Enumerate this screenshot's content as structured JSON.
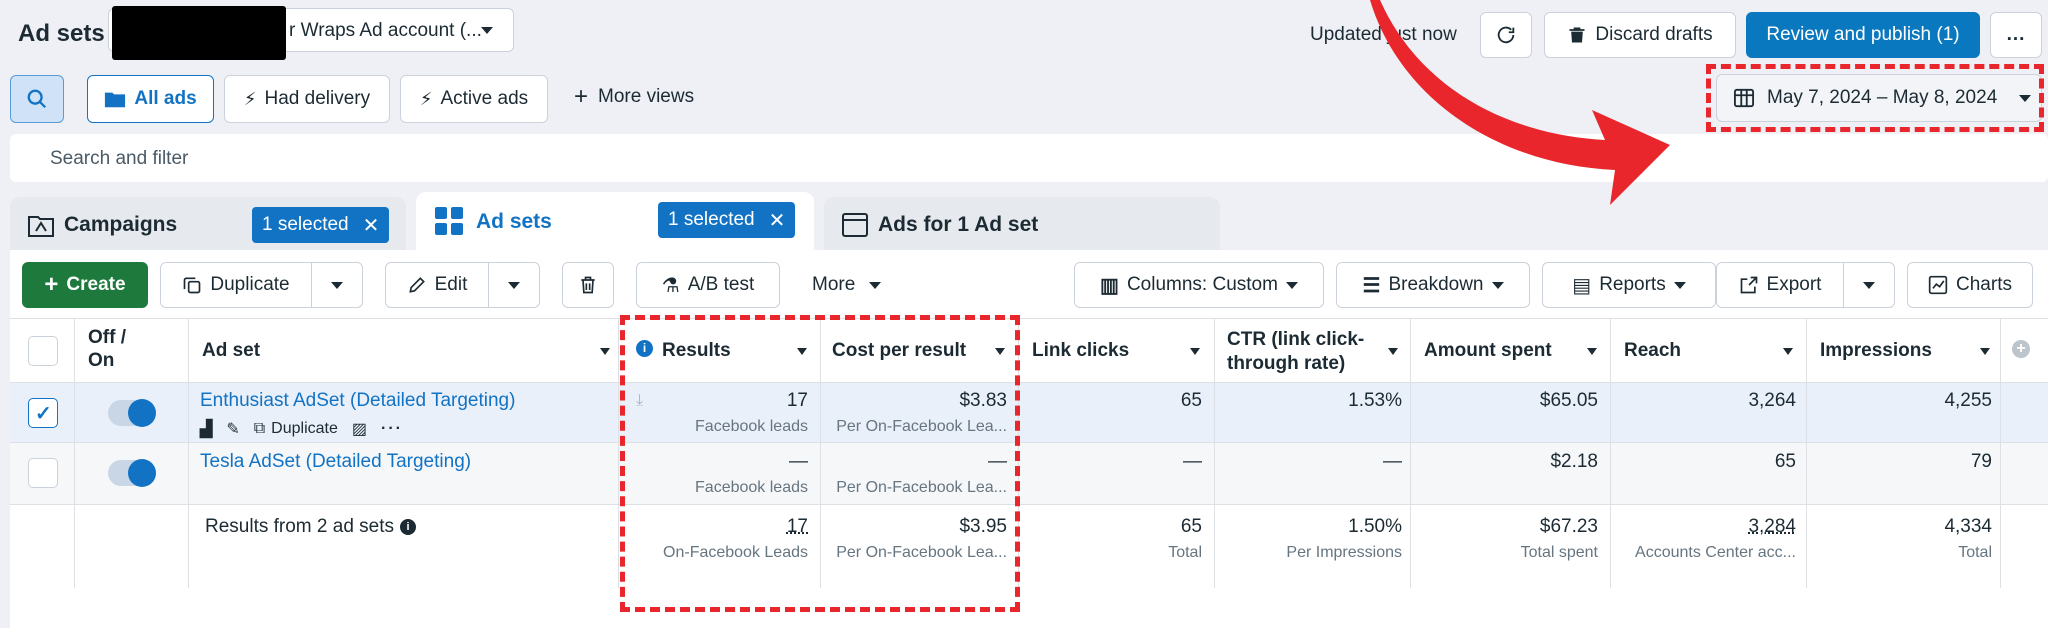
{
  "header": {
    "title": "Ad sets",
    "account_label": "r Wraps Ad account (...",
    "updated_text": "Updated just now",
    "discard_label": "Discard drafts",
    "publish_label": "Review and publish (1)",
    "more_label": "..."
  },
  "views": {
    "all_ads": "All ads",
    "had_delivery": "Had delivery",
    "active_ads": "Active ads",
    "more_views": "More views"
  },
  "date_range": "May 7, 2024 – May 8, 2024",
  "search": {
    "placeholder": "Search and filter"
  },
  "tabs": {
    "campaigns": {
      "label": "Campaigns",
      "badge": "1 selected"
    },
    "adsets": {
      "label": "Ad sets",
      "badge": "1 selected"
    },
    "ads": {
      "label": "Ads for 1 Ad set"
    }
  },
  "toolbar": {
    "create": "Create",
    "duplicate": "Duplicate",
    "edit": "Edit",
    "ab_test": "A/B test",
    "more": "More",
    "columns": "Columns: Custom",
    "breakdown": "Breakdown",
    "reports": "Reports",
    "export": "Export",
    "charts": "Charts"
  },
  "table": {
    "headers": {
      "offon": "Off /\nOn",
      "adset": "Ad set",
      "results": "Results",
      "cost": "Cost per result",
      "link_clicks": "Link clicks",
      "ctr": "CTR (link click-\nthrough rate)",
      "amount": "Amount spent",
      "reach": "Reach",
      "impressions": "Impressions"
    },
    "rows": [
      {
        "name": "Enthusiast AdSet (Detailed Targeting)",
        "duplicate_label": "Duplicate",
        "results": "17",
        "results_sub": "Facebook leads",
        "cost": "$3.83",
        "cost_sub": "Per On-Facebook Lea...",
        "link_clicks": "65",
        "ctr": "1.53%",
        "amount": "$65.05",
        "reach": "3,264",
        "impressions": "4,255"
      },
      {
        "name": "Tesla AdSet (Detailed Targeting)",
        "results": "—",
        "results_sub": "Facebook leads",
        "cost": "—",
        "cost_sub": "Per On-Facebook Lea...",
        "link_clicks": "—",
        "ctr": "—",
        "amount": "$2.18",
        "reach": "65",
        "impressions": "79"
      }
    ],
    "totals": {
      "label": "Results from 2 ad sets",
      "results": "17",
      "results_sub": "On-Facebook Leads",
      "cost": "$3.95",
      "cost_sub": "Per On-Facebook Lea...",
      "link_clicks": "65",
      "link_clicks_sub": "Total",
      "ctr": "1.50%",
      "ctr_sub": "Per Impressions",
      "amount": "$67.23",
      "amount_sub": "Total spent",
      "reach": "3,284",
      "reach_sub": "Accounts Center acc...",
      "impressions": "4,334",
      "impressions_sub": "Total"
    }
  },
  "colors": {
    "accent": "#0a78be",
    "create_green": "#1e7a3c",
    "annotation_red": "#e8262b"
  }
}
